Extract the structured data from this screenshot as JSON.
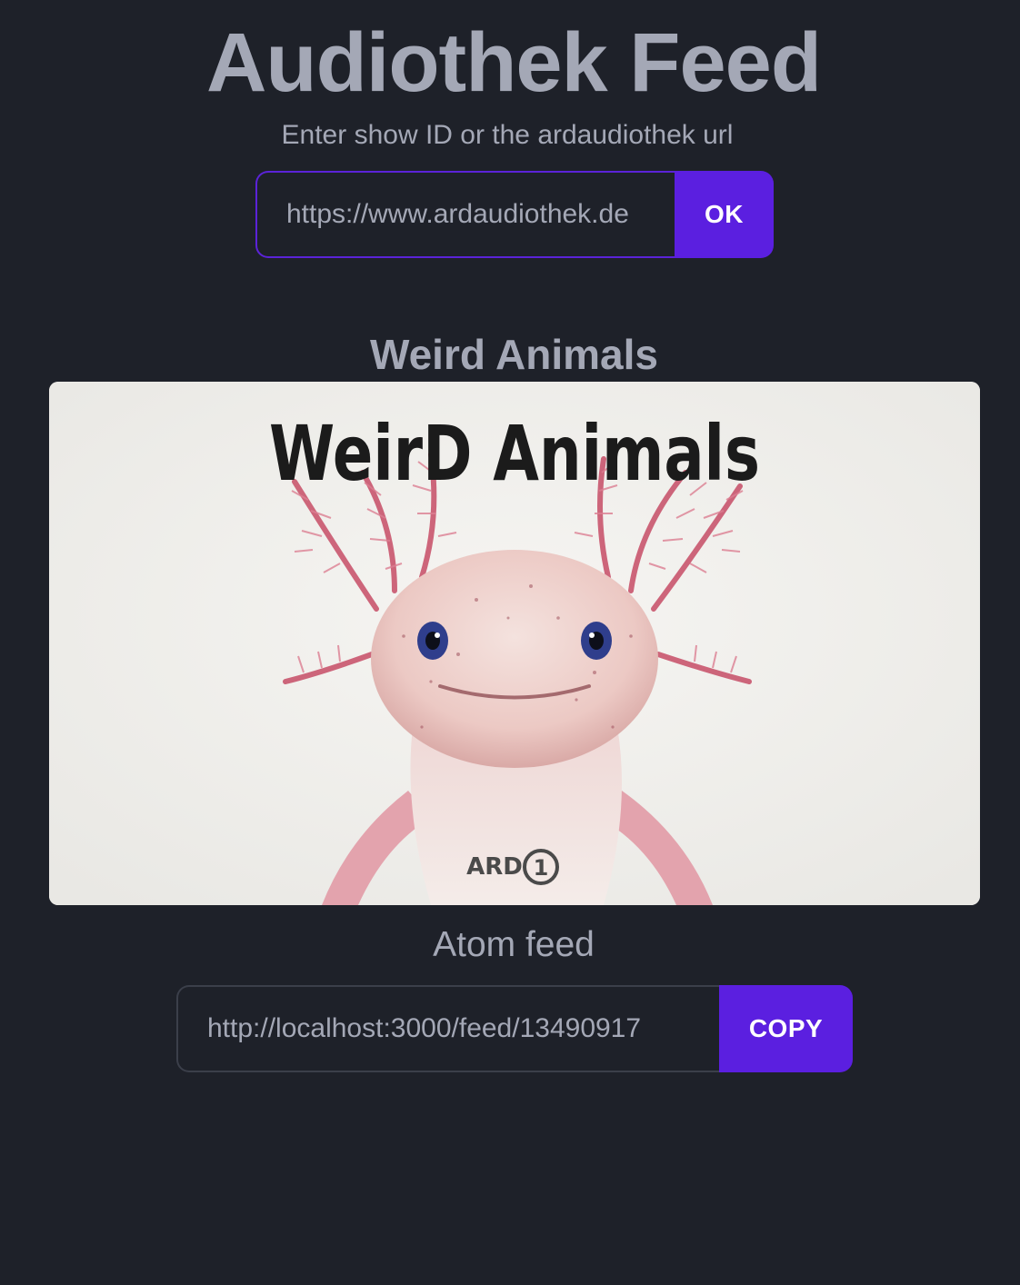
{
  "header": {
    "title": "Audiothek Feed",
    "subtitle": "Enter show ID or the ardaudiothek url"
  },
  "search": {
    "value": "https://www.ardaudiothek.de",
    "button_label": "OK"
  },
  "show": {
    "title": "Weird Animals",
    "cover": {
      "lettering": "WeirD Animals",
      "brand": "ARD",
      "brand_mark": "1",
      "icon": "axolotl-image"
    }
  },
  "feed": {
    "label": "Atom feed",
    "url": "http://localhost:3000/feed/13490917",
    "button_label": "COPY"
  },
  "colors": {
    "background": "#1e2129",
    "text": "#a4a8b6",
    "accent": "#5b1fe0"
  }
}
